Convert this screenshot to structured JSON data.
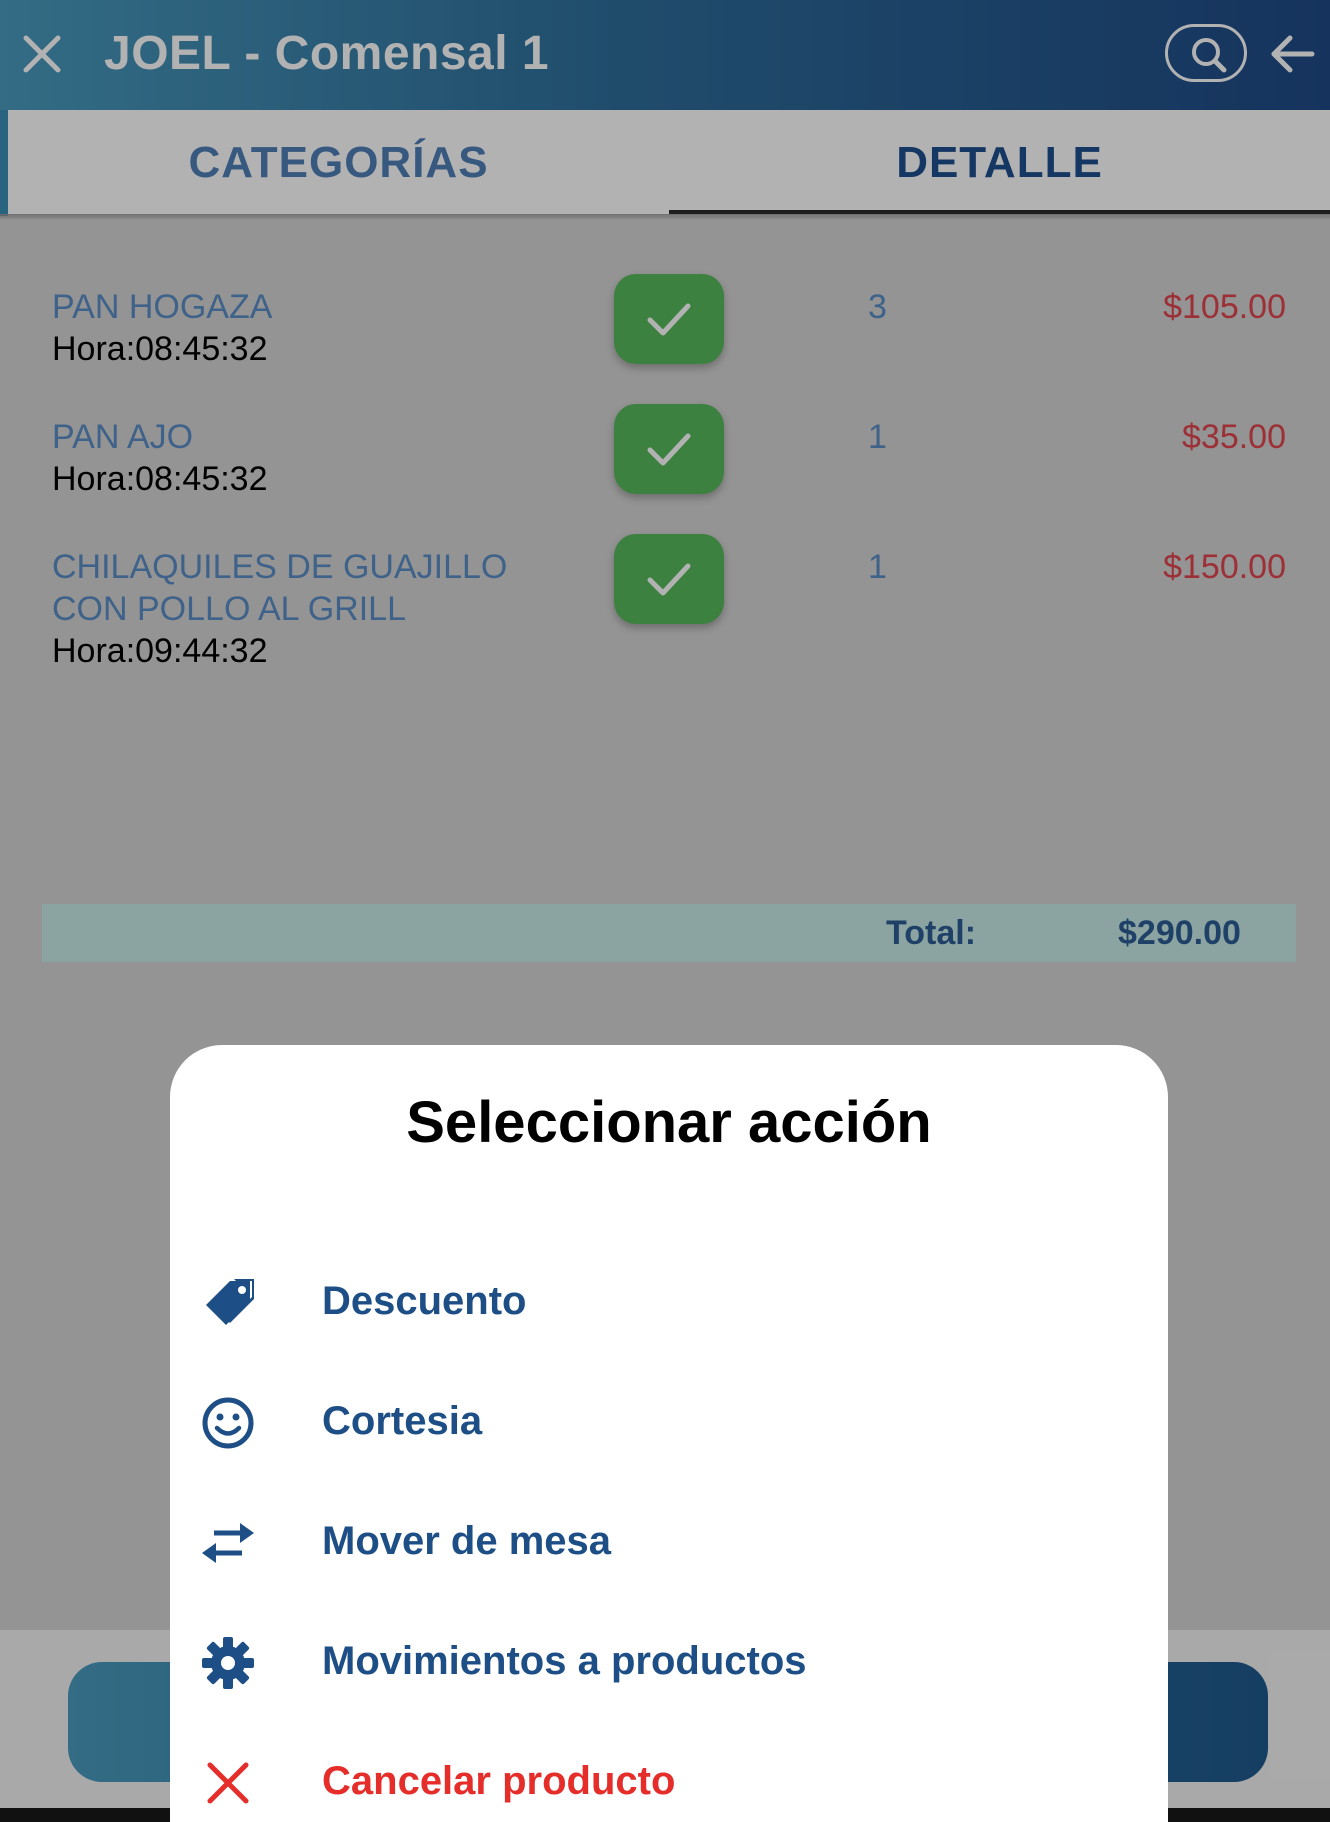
{
  "header": {
    "title": "JOEL - Comensal 1"
  },
  "tabs": [
    {
      "label": "CATEGORÍAS",
      "active": false
    },
    {
      "label": "DETALLE",
      "active": true
    }
  ],
  "items": [
    {
      "name": "PAN HOGAZA",
      "time": "Hora:08:45:32",
      "qty": "3",
      "price": "$105.00"
    },
    {
      "name": "PAN AJO",
      "time": "Hora:08:45:32",
      "qty": "1",
      "price": "$35.00"
    },
    {
      "name": "CHILAQUILES DE GUAJILLO CON POLLO AL GRILL",
      "time": "Hora:09:44:32",
      "qty": "1",
      "price": "$150.00"
    }
  ],
  "total": {
    "label": "Total:",
    "value": "$290.00"
  },
  "dialog": {
    "title": "Seleccionar acción",
    "options": [
      {
        "label": "Descuento",
        "icon": "tag-icon"
      },
      {
        "label": "Cortesia",
        "icon": "smiley-icon"
      },
      {
        "label": "Mover de mesa",
        "icon": "swap-arrows-icon"
      },
      {
        "label": "Movimientos a productos",
        "icon": "gear-icon"
      },
      {
        "label": "Cancelar producto",
        "icon": "close-icon"
      }
    ]
  },
  "colors": {
    "accent_blue": "#1d4f86",
    "danger_red": "#e52d2a",
    "check_green": "#58b95e",
    "price_red": "#e0464e"
  }
}
